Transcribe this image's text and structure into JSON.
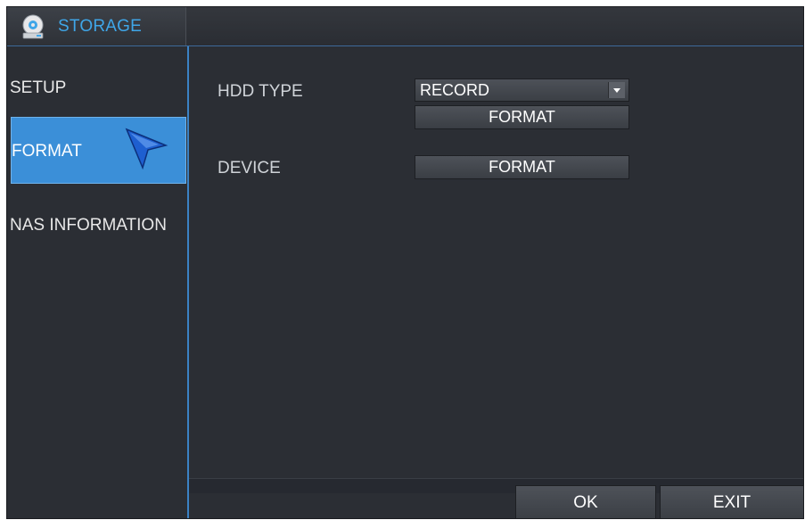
{
  "window": {
    "title": "STORAGE",
    "title_icon": "storage-disc-icon"
  },
  "sidebar": {
    "items": [
      {
        "label": "SETUP",
        "selected": false
      },
      {
        "label": "FORMAT",
        "selected": true
      },
      {
        "label": "NAS INFORMATION",
        "selected": false
      }
    ]
  },
  "main": {
    "hdd_type": {
      "label": "HDD TYPE",
      "selected_value": "RECORD",
      "format_button": "FORMAT"
    },
    "device": {
      "label": "DEVICE",
      "format_button": "FORMAT"
    }
  },
  "footer": {
    "ok_label": "OK",
    "exit_label": "EXIT"
  },
  "colors": {
    "accent": "#3b8fd8",
    "title_text": "#3fa6e8",
    "background": "#2b2e34"
  }
}
